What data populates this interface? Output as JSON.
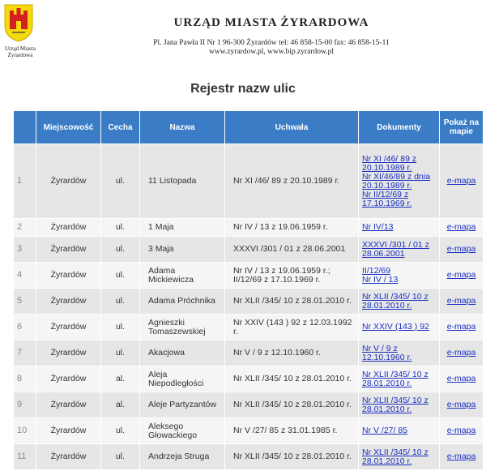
{
  "header": {
    "crest_caption_line1": "Urząd Miasta",
    "crest_caption_line2": "Żyrardowa",
    "office_title": "URZĄD MIASTA ŻYRARDOWA",
    "address_line": "Pl. Jana Pawła II Nr 1 96-300 Żyrardów tel: 46 858-15-00 fax: 46 858-15-11",
    "web_line": "www.zyrardow.pl, www.bip.zyrardow.pl"
  },
  "page_title": "Rejestr nazw ulic",
  "table": {
    "headers": {
      "lp": "",
      "miejscowosc": "Miejscowość",
      "cecha": "Cecha",
      "nazwa": "Nazwa",
      "uchwala": "Uchwała",
      "dokumenty": "Dokumenty",
      "mapa": "Pokaż na mapie"
    },
    "rows": [
      {
        "lp": "1",
        "miejscowosc": "Żyrardów",
        "cecha": "ul.",
        "nazwa": "11 Listopada",
        "uchwala": "Nr XI /46/ 89 z 20.10.1989 r.",
        "dokumenty": [
          "Nr XI /46/ 89 z 20.10.1989 r.",
          "Nr XI/46/89 z dnia 20.10.1989 r.",
          "Nr II/12/69 z 17.10.1969 r."
        ],
        "mapa": "e-mapa"
      },
      {
        "lp": "2",
        "miejscowosc": "Żyrardów",
        "cecha": "ul.",
        "nazwa": "1 Maja",
        "uchwala": "Nr IV / 13 z 19.06.1959 r.",
        "dokumenty": [
          "Nr IV/13"
        ],
        "mapa": "e-mapa"
      },
      {
        "lp": "3",
        "miejscowosc": "Żyrardów",
        "cecha": "ul.",
        "nazwa": "3 Maja",
        "uchwala": "XXXVI /301 / 01 z 28.06.2001",
        "dokumenty": [
          "XXXVI /301 / 01 z 28.06.2001"
        ],
        "mapa": "e-mapa"
      },
      {
        "lp": "4",
        "miejscowosc": "Żyrardów",
        "cecha": "ul.",
        "nazwa": "Adama Mickiewicza",
        "uchwala": "Nr IV / 13 z 19.06.1959 r.; II/12/69 z 17.10.1969 r.",
        "dokumenty": [
          "II/12/69",
          "Nr IV / 13"
        ],
        "mapa": "e-mapa"
      },
      {
        "lp": "5",
        "miejscowosc": "Żyrardów",
        "cecha": "ul.",
        "nazwa": "Adama Próchnika",
        "uchwala": "Nr XLII /345/ 10 z 28.01.2010 r.",
        "dokumenty": [
          "Nr XLII /345/ 10 z 28.01.2010 r."
        ],
        "mapa": "e-mapa"
      },
      {
        "lp": "6",
        "miejscowosc": "Żyrardów",
        "cecha": "ul.",
        "nazwa": "Agnieszki Tomaszewskiej",
        "uchwala": "Nr XXIV (143 ) 92 z 12.03.1992 r.",
        "dokumenty": [
          "Nr XXIV (143 ) 92"
        ],
        "mapa": "e-mapa"
      },
      {
        "lp": "7",
        "miejscowosc": "Żyrardów",
        "cecha": "ul.",
        "nazwa": "Akacjowa",
        "uchwala": "Nr V / 9 z 12.10.1960 r.",
        "dokumenty": [
          "Nr V / 9 z 12.10.1960 r."
        ],
        "mapa": "e-mapa"
      },
      {
        "lp": "8",
        "miejscowosc": "Żyrardów",
        "cecha": "al.",
        "nazwa": "Aleja Niepodległości",
        "uchwala": "Nr XLII /345/ 10 z 28.01.2010 r.",
        "dokumenty": [
          "Nr XLII /345/ 10 z 28.01.2010 r."
        ],
        "mapa": "e-mapa"
      },
      {
        "lp": "9",
        "miejscowosc": "Żyrardów",
        "cecha": "al.",
        "nazwa": "Aleje Partyzantów",
        "uchwala": "Nr XLII /345/ 10 z 28.01.2010 r.",
        "dokumenty": [
          "Nr XLII /345/ 10 z 28.01.2010 r."
        ],
        "mapa": "e-mapa"
      },
      {
        "lp": "10",
        "miejscowosc": "Żyrardów",
        "cecha": "ul.",
        "nazwa": "Aleksego Głowackiego",
        "uchwala": "Nr V /27/ 85 z 31.01.1985 r.",
        "dokumenty": [
          "Nr V /27/ 85"
        ],
        "mapa": "e-mapa"
      },
      {
        "lp": "11",
        "miejscowosc": "Żyrardów",
        "cecha": "ul.",
        "nazwa": "Andrzeja Struga",
        "uchwala": "Nr XLII /345/ 10 z 28.01.2010 r.",
        "dokumenty": [
          "Nr XLII /345/ 10 z 28.01.2010 r."
        ],
        "mapa": "e-mapa"
      }
    ]
  }
}
